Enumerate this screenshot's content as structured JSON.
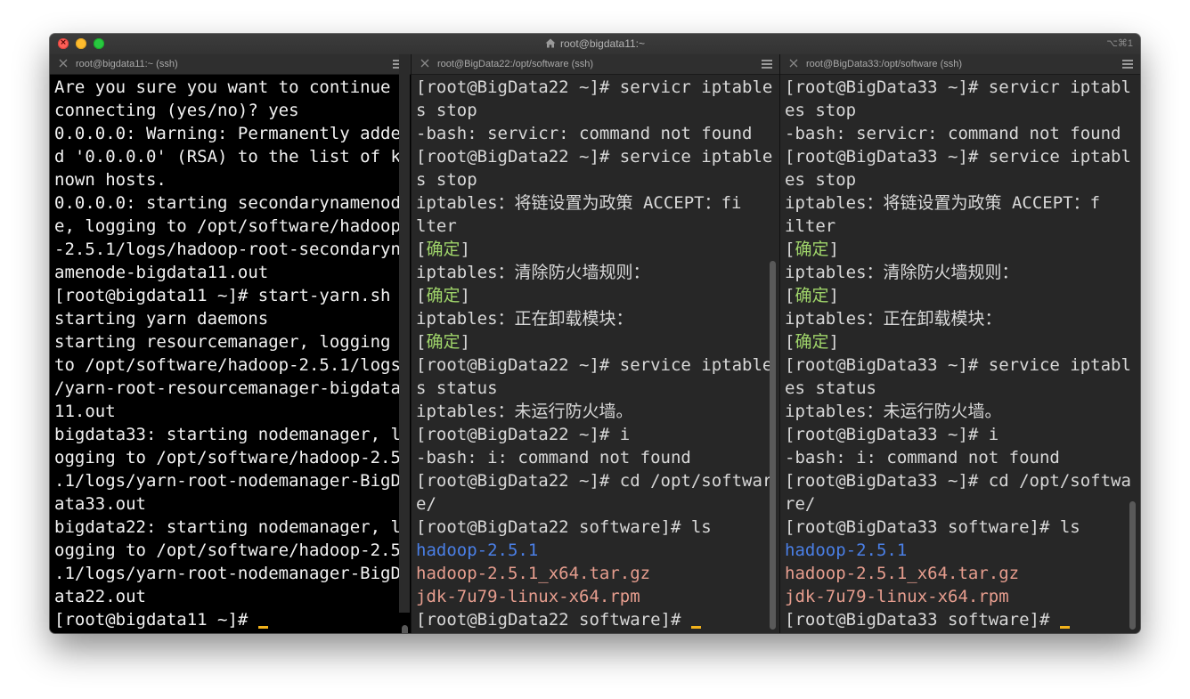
{
  "window": {
    "title": "root@bigdata11:~",
    "shortcut": "⌥⌘1",
    "home_icon": "home-icon"
  },
  "panes": [
    {
      "tab_title": "root@bigdata11:~ (ssh)",
      "lines": [
        {
          "text": "Are you sure you want to continue"
        },
        {
          "text": "connecting (yes/no)? yes"
        },
        {
          "text": "0.0.0.0: Warning: Permanently adde"
        },
        {
          "text": "d '0.0.0.0' (RSA) to the list of k"
        },
        {
          "text": "nown hosts."
        },
        {
          "text": "0.0.0.0: starting secondarynamenod"
        },
        {
          "text": "e, logging to /opt/software/hadoop"
        },
        {
          "text": "-2.5.1/logs/hadoop-root-secondaryn"
        },
        {
          "text": "amenode-bigdata11.out"
        },
        {
          "text": "[root@bigdata11 ~]# start-yarn.sh"
        },
        {
          "text": "starting yarn daemons"
        },
        {
          "text": "starting resourcemanager, logging"
        },
        {
          "text": "to /opt/software/hadoop-2.5.1/logs"
        },
        {
          "text": "/yarn-root-resourcemanager-bigdata"
        },
        {
          "text": "11.out"
        },
        {
          "text": "bigdata33: starting nodemanager, l"
        },
        {
          "text": "ogging to /opt/software/hadoop-2.5"
        },
        {
          "text": ".1/logs/yarn-root-nodemanager-BigD"
        },
        {
          "text": "ata33.out"
        },
        {
          "text": "bigdata22: starting nodemanager, l"
        },
        {
          "text": "ogging to /opt/software/hadoop-2.5"
        },
        {
          "text": ".1/logs/yarn-root-nodemanager-BigD"
        },
        {
          "text": "ata22.out"
        },
        {
          "text": "[root@bigdata11 ~]# ",
          "cursor": true
        }
      ]
    },
    {
      "tab_title": "root@BigData22:/opt/software (ssh)",
      "lines": [
        {
          "text": "[root@BigData22 ~]# servicr iptable"
        },
        {
          "text": "s stop"
        },
        {
          "text": "-bash: servicr: command not found"
        },
        {
          "text": "[root@BigData22 ~]# service iptable"
        },
        {
          "text": "s stop"
        },
        {
          "text": "iptables：将链设置为政策 ACCEPT：fi"
        },
        {
          "text": "lter"
        },
        {
          "pre": "[",
          "hl": "确定",
          "post": "]"
        },
        {
          "text": "iptables：清除防火墙规则："
        },
        {
          "pre": "[",
          "hl": "确定",
          "post": "]"
        },
        {
          "text": "iptables：正在卸载模块："
        },
        {
          "pre": "[",
          "hl": "确定",
          "post": "]"
        },
        {
          "text": "[root@BigData22 ~]# service iptable"
        },
        {
          "text": "s status"
        },
        {
          "text": "iptables：未运行防火墙。"
        },
        {
          "text": "[root@BigData22 ~]# i"
        },
        {
          "text": "-bash: i: command not found"
        },
        {
          "text": "[root@BigData22 ~]# cd /opt/softwar"
        },
        {
          "text": "e/"
        },
        {
          "text": "[root@BigData22 software]# ls"
        },
        {
          "text": "hadoop-2.5.1",
          "color": "blue"
        },
        {
          "text": "hadoop-2.5.1_x64.tar.gz",
          "color": "salmon"
        },
        {
          "text": "jdk-7u79-linux-x64.rpm",
          "color": "salmon"
        },
        {
          "text": "[root@BigData22 software]# ",
          "cursor": true
        }
      ]
    },
    {
      "tab_title": "root@BigData33:/opt/software (ssh)",
      "lines": [
        {
          "text": "[root@BigData33 ~]# servicr iptabl"
        },
        {
          "text": "es stop"
        },
        {
          "text": "-bash: servicr: command not found"
        },
        {
          "text": "[root@BigData33 ~]# service iptabl"
        },
        {
          "text": "es stop"
        },
        {
          "text": "iptables：将链设置为政策 ACCEPT：f"
        },
        {
          "text": "ilter"
        },
        {
          "pre": "[",
          "hl": "确定",
          "post": "]"
        },
        {
          "text": "iptables：清除防火墙规则："
        },
        {
          "pre": "[",
          "hl": "确定",
          "post": "]"
        },
        {
          "text": "iptables：正在卸载模块："
        },
        {
          "pre": "[",
          "hl": "确定",
          "post": "]"
        },
        {
          "text": "[root@BigData33 ~]# service iptabl"
        },
        {
          "text": "es status"
        },
        {
          "text": "iptables：未运行防火墙。"
        },
        {
          "text": "[root@BigData33 ~]# i"
        },
        {
          "text": "-bash: i: command not found"
        },
        {
          "text": "[root@BigData33 ~]# cd /opt/softwa"
        },
        {
          "text": "re/"
        },
        {
          "text": "[root@BigData33 software]# ls"
        },
        {
          "text": "hadoop-2.5.1",
          "color": "blue"
        },
        {
          "text": "hadoop-2.5.1_x64.tar.gz",
          "color": "salmon"
        },
        {
          "text": "jdk-7u79-linux-x64.rpm",
          "color": "salmon"
        },
        {
          "text": "[root@BigData33 software]# ",
          "cursor": true
        }
      ]
    }
  ],
  "colors": {
    "ok_green": "#9fd46a",
    "dir_blue": "#4a7fe6",
    "archive_salmon": "#e69d8e",
    "cursor": "#f2b21b"
  }
}
